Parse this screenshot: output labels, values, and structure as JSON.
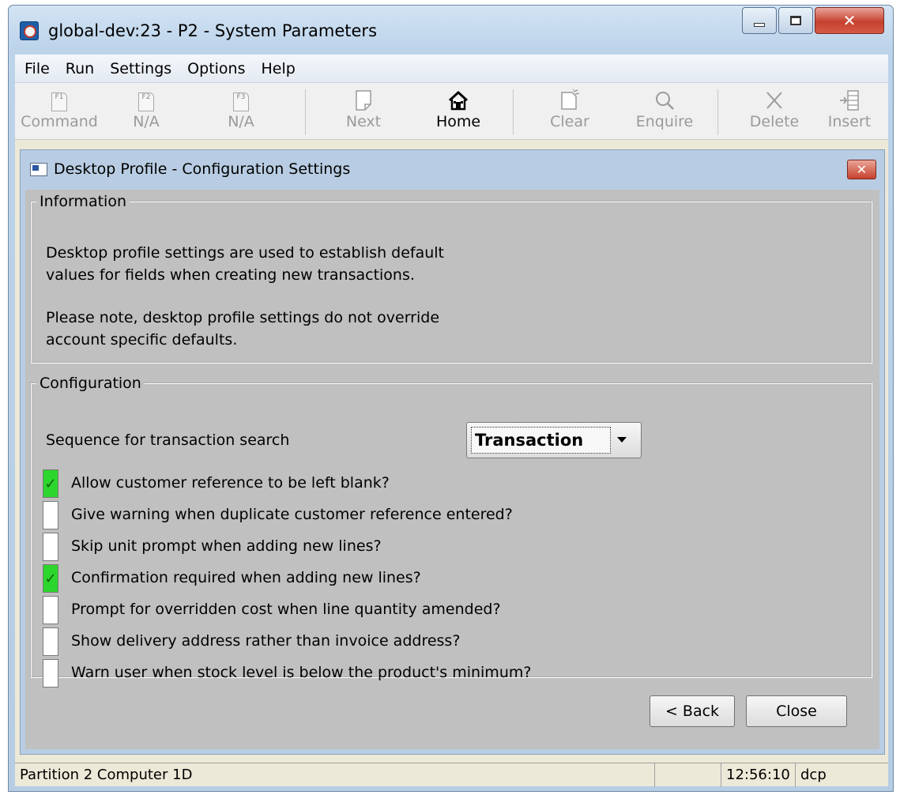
{
  "window": {
    "title": "global-dev:23 - P2 - System Parameters"
  },
  "menu": [
    "File",
    "Run",
    "Settings",
    "Options",
    "Help"
  ],
  "toolbar": [
    {
      "label": "Command",
      "key": "F1"
    },
    {
      "label": "N/A",
      "key": "F2"
    },
    {
      "label": "N/A",
      "key": "F3"
    },
    {
      "label": "Next"
    },
    {
      "label": "Home"
    },
    {
      "label": "Clear"
    },
    {
      "label": "Enquire"
    },
    {
      "label": "Delete"
    },
    {
      "label": "Insert"
    }
  ],
  "dialog": {
    "title": "Desktop Profile - Configuration Settings",
    "information": {
      "legend": "Information",
      "line1": "Desktop profile settings are used to establish default",
      "line2": "values for fields when creating new transactions.",
      "line3": "Please note, desktop profile settings do not override",
      "line4": "account specific defaults."
    },
    "configuration": {
      "legend": "Configuration",
      "sequence_label": "Sequence for transaction search",
      "sequence_value": "Transaction",
      "options": [
        {
          "label": "Allow customer reference to be left blank?",
          "checked": true
        },
        {
          "label": "Give warning when duplicate customer reference entered?",
          "checked": false
        },
        {
          "label": "Skip unit prompt when adding new lines?",
          "checked": false
        },
        {
          "label": "Confirmation required when adding new lines?",
          "checked": true
        },
        {
          "label": "Prompt for overridden cost when line quantity amended?",
          "checked": false
        },
        {
          "label": "Show delivery address rather than invoice address?",
          "checked": false
        },
        {
          "label": "Warn user when stock level is below the product's minimum?",
          "checked": false
        }
      ]
    },
    "buttons": {
      "back": "< Back",
      "close": "Close"
    }
  },
  "status": {
    "partition": "Partition 2 Computer 1D",
    "time": "12:56:10",
    "user": "dcp"
  },
  "colors": {
    "checked": "#2cd62c",
    "panel": "#c0c0c0",
    "frame": "#b8cde3"
  }
}
